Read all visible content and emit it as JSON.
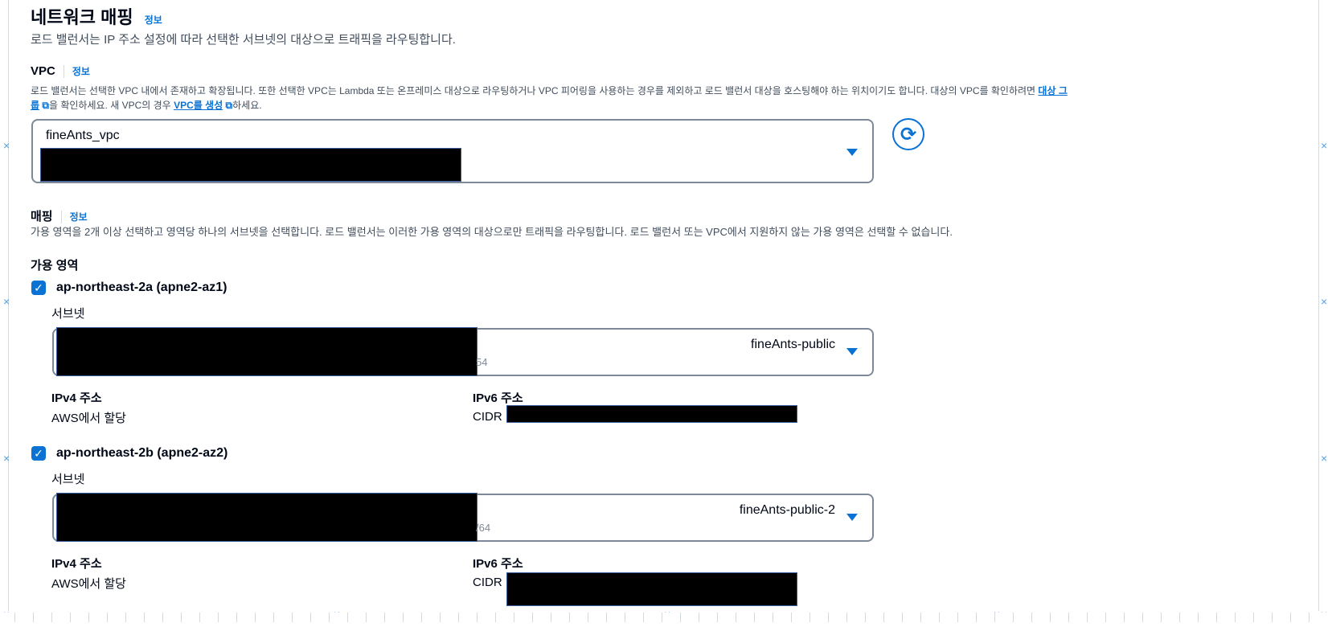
{
  "section": {
    "title": "네트워크 매핑",
    "info": "정보",
    "description": "로드 밸런서는 IP 주소 설정에 따라 선택한 서브넷의 대상으로 트래픽을 라우팅합니다."
  },
  "vpc": {
    "label": "VPC",
    "info": "정보",
    "description_line1_prefix": "로드 밸런서는 선택한 VPC 내에서 존재하고 확장됩니다. 또한 선택한 VPC는 Lambda 또는 온프레미스 대상으로 라우팅하거나 VPC 피어링을 사용하는 경우를 제외하고 로드 밸런서 대상을 호스팅해야 하는 위치이기도 합니다. 대상의 VPC를 확인하려면",
    "target_group_link_part1": "대상 그",
    "target_group_link_part2": "룹",
    "description_line2_mid": "을 확인하세요. 새 VPC의 경우",
    "create_vpc_link": "VPC를 생성",
    "description_line2_suffix": "하세요.",
    "external_icon": "external-link-icon",
    "selected_vpc": "fineAnts_vpc",
    "refresh_icon": "refresh-icon"
  },
  "mapping": {
    "label": "매핑",
    "info": "정보",
    "description": "가용 영역을 2개 이상 선택하고 영역당 하나의 서브넷을 선택합니다. 로드 밸런서는 이러한 가용 영역의 대상으로만 트래픽을 라우팅합니다. 로드 밸런서 또는 VPC에서 지원하지 않는 가용 영역은 선택할 수 없습니다.",
    "az_heading": "가용 영역",
    "zones": [
      {
        "name": "ap-northeast-2a (apne2-az1)",
        "checked": true,
        "subnet_label": "서브넷",
        "subnet_name": "fineAnts-public",
        "subnet_suffix": "54",
        "ipv4_label": "IPv4 주소",
        "ipv4_value": "AWS에서 할당",
        "ipv6_label": "IPv6 주소",
        "ipv6_prefix": "CIDR"
      },
      {
        "name": "ap-northeast-2b (apne2-az2)",
        "checked": true,
        "subnet_label": "서브넷",
        "subnet_name": "fineAnts-public-2",
        "subnet_suffix": "/64",
        "ipv4_label": "IPv4 주소",
        "ipv4_value": "AWS에서 할당",
        "ipv6_label": "IPv6 주소",
        "ipv6_prefix": "CIDR"
      }
    ]
  },
  "colors": {
    "accent": "#0972d3",
    "text": "#000716",
    "muted": "#414d5c",
    "border": "#7d8998"
  }
}
